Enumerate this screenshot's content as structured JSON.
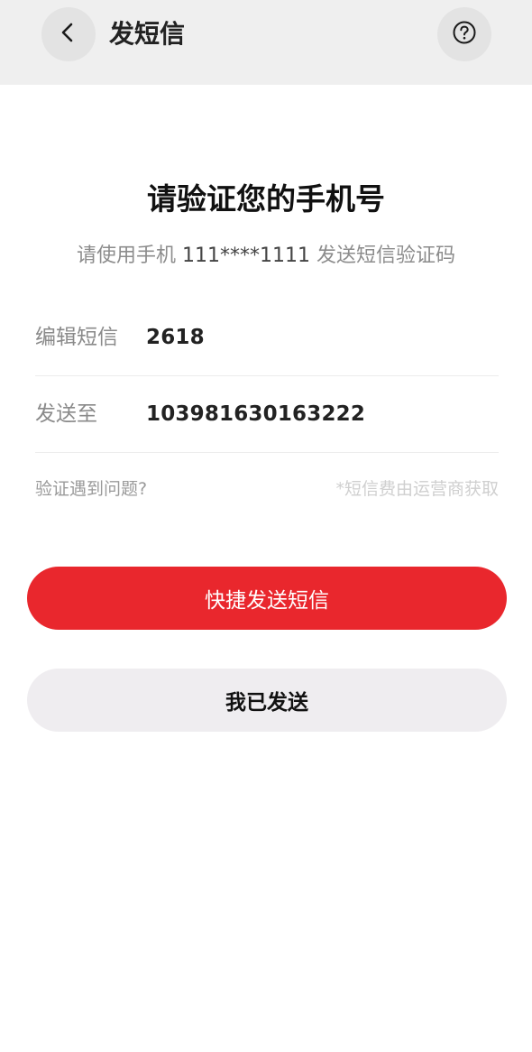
{
  "header": {
    "title": "发短信"
  },
  "main": {
    "title": "请验证您的手机号",
    "subtitle_prefix": "请使用手机",
    "phone_masked": "111****1111",
    "subtitle_suffix": "发送短信验证码"
  },
  "form": {
    "sms": {
      "label": "编辑短信",
      "value": "2618"
    },
    "send_to": {
      "label": "发送至",
      "value": "103981630163222"
    }
  },
  "footer": {
    "help_link": "验证遇到问题?",
    "fee_note": "*短信费由运营商获取"
  },
  "buttons": {
    "primary": "快捷发送短信",
    "secondary": "我已发送"
  },
  "colors": {
    "accent": "#e9272d",
    "header_bg": "#efefef",
    "secondary_button_bg": "#efedf0"
  },
  "icons": {
    "back": "chevron-left-icon",
    "help": "question-circle-icon"
  }
}
